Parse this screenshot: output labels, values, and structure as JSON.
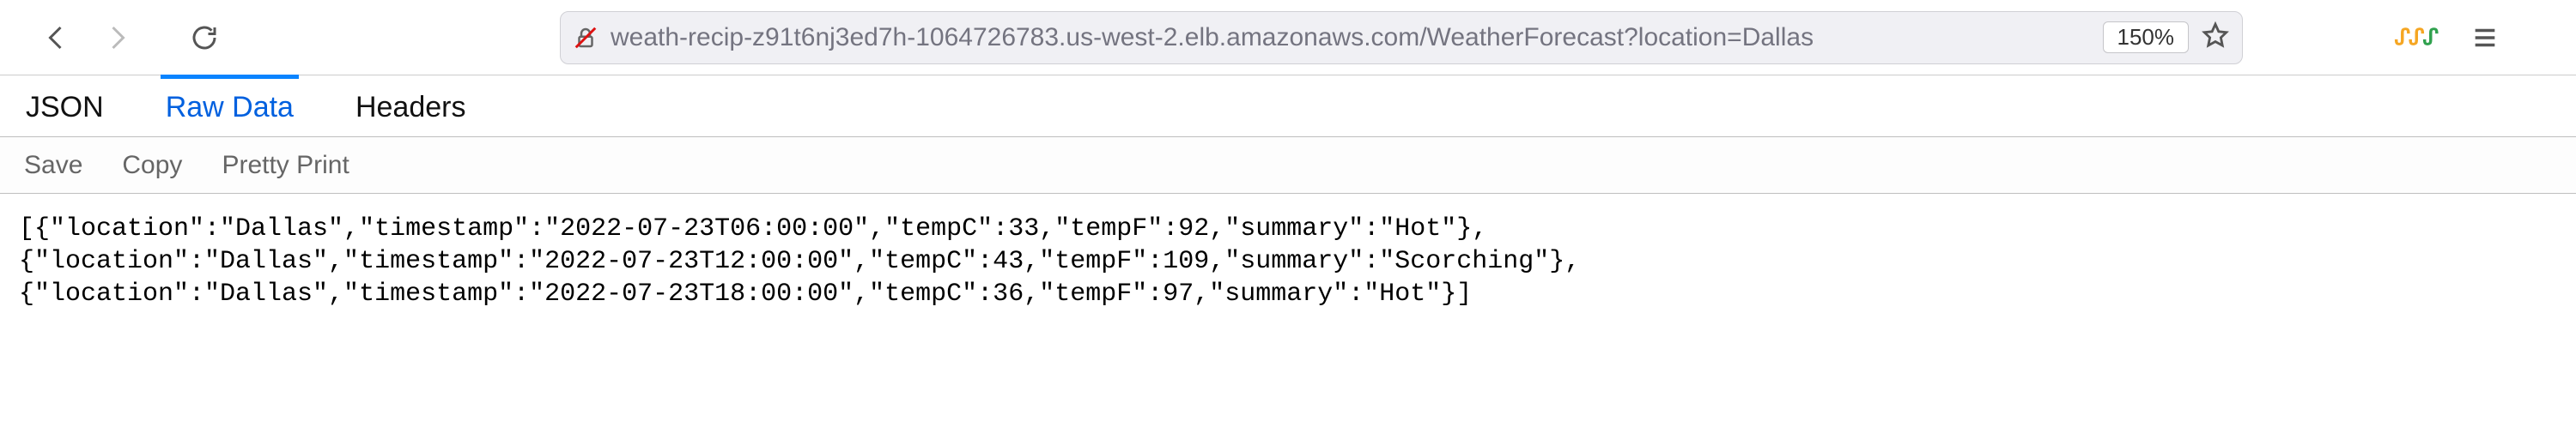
{
  "toolbar": {
    "url": "weath-recip-z91t6nj3ed7h-1064726783.us-west-2.elb.amazonaws.com/WeatherForecast?location=Dallas",
    "zoom_label": "150%"
  },
  "viewer": {
    "tabs": {
      "json": "JSON",
      "raw": "Raw Data",
      "headers": "Headers"
    },
    "actions": {
      "save": "Save",
      "copy": "Copy",
      "pretty": "Pretty Print"
    }
  },
  "response_rows": [
    "[{\"location\":\"Dallas\",\"timestamp\":\"2022-07-23T06:00:00\",\"tempC\":33,\"tempF\":92,\"summary\":\"Hot\"},",
    "{\"location\":\"Dallas\",\"timestamp\":\"2022-07-23T12:00:00\",\"tempC\":43,\"tempF\":109,\"summary\":\"Scorching\"},",
    "{\"location\":\"Dallas\",\"timestamp\":\"2022-07-23T18:00:00\",\"tempC\":36,\"tempF\":97,\"summary\":\"Hot\"}]"
  ]
}
